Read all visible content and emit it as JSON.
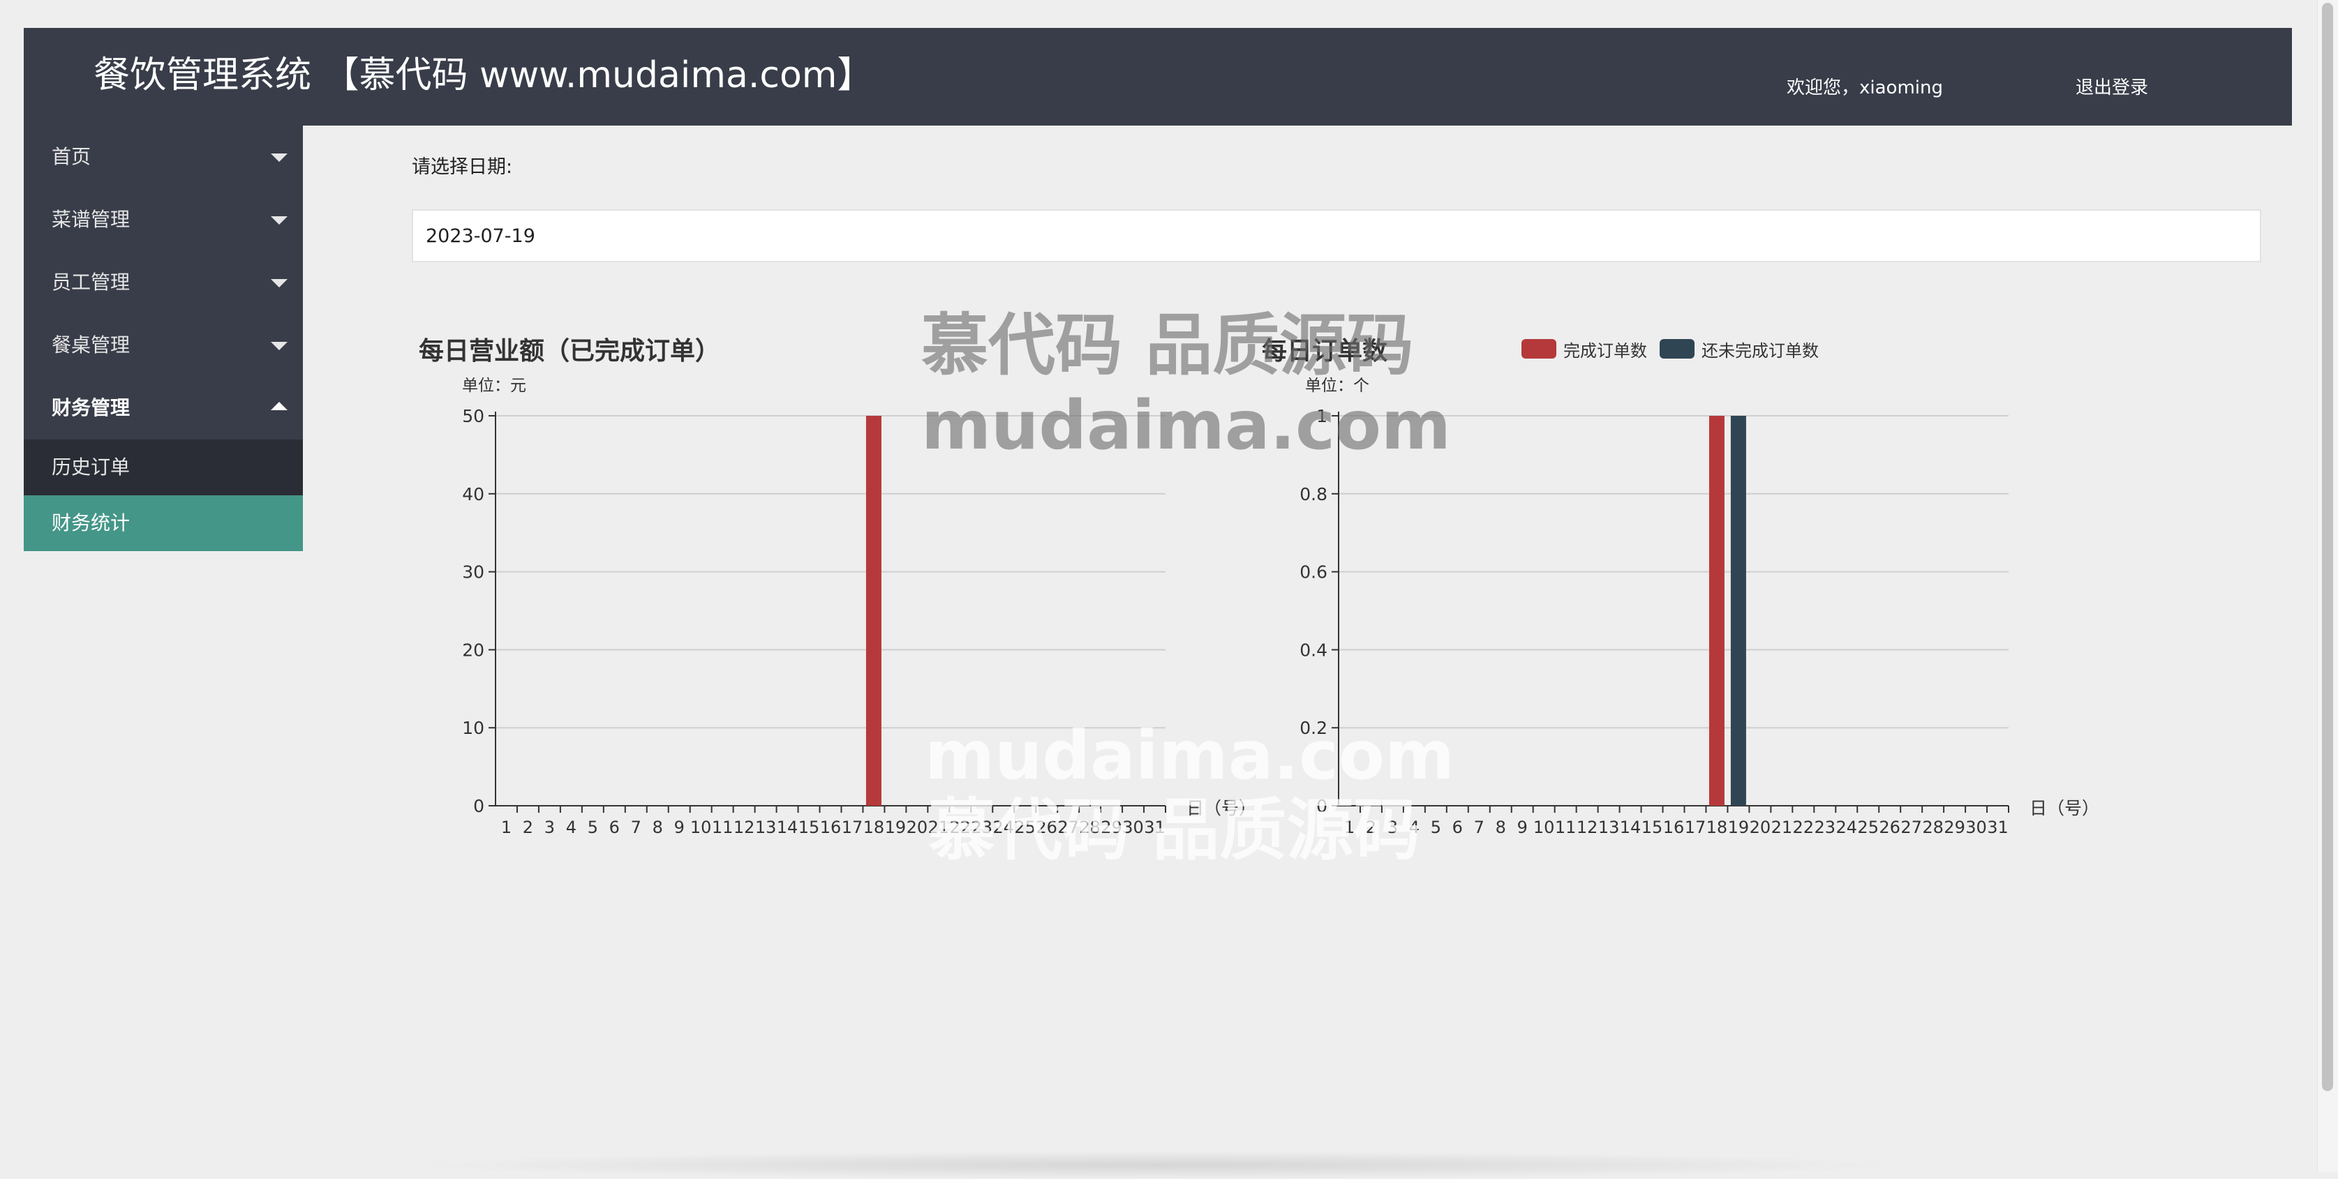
{
  "header": {
    "title": "餐饮管理系统 【慕代码 www.mudaima.com】",
    "welcome": "欢迎您，xiaoming",
    "logout": "退出登录"
  },
  "sidebar": {
    "items": [
      {
        "label": "首页"
      },
      {
        "label": "菜谱管理"
      },
      {
        "label": "员工管理"
      },
      {
        "label": "餐桌管理"
      },
      {
        "label": "财务管理"
      }
    ],
    "submenu": [
      {
        "label": "历史订单"
      },
      {
        "label": "财务统计"
      }
    ]
  },
  "main": {
    "date_label": "请选择日期:",
    "date_value": "2023-07-19"
  },
  "watermark": {
    "line1": "慕代码 品质源码",
    "line2": "mudaima.com"
  },
  "colors": {
    "header_bg": "#393d49",
    "active_menu": "#449688",
    "completed": "#b5393a",
    "uncompleted": "#2f4554"
  },
  "chart_data": [
    {
      "type": "bar",
      "title": "每日营业额（已完成订单）",
      "unit": "单位：元",
      "xlabel": "日（号）",
      "categories": [
        "1",
        "2",
        "3",
        "4",
        "5",
        "6",
        "7",
        "8",
        "9",
        "10",
        "11",
        "12",
        "13",
        "14",
        "15",
        "16",
        "17",
        "18",
        "19",
        "20",
        "21",
        "22",
        "23",
        "24",
        "25",
        "26",
        "27",
        "28",
        "29",
        "30",
        "31"
      ],
      "ylim": [
        0,
        50
      ],
      "yticks": [
        "0",
        "10",
        "20",
        "30",
        "40",
        "50"
      ],
      "series": [
        {
          "values": [
            0,
            0,
            0,
            0,
            0,
            0,
            0,
            0,
            0,
            0,
            0,
            0,
            0,
            0,
            0,
            0,
            0,
            50,
            0,
            0,
            0,
            0,
            0,
            0,
            0,
            0,
            0,
            0,
            0,
            0,
            0
          ]
        }
      ],
      "grid": true
    },
    {
      "type": "bar",
      "title": "每日订单数",
      "unit": "单位：个",
      "xlabel": "日（号）",
      "categories": [
        "1",
        "2",
        "3",
        "4",
        "5",
        "6",
        "7",
        "8",
        "9",
        "10",
        "11",
        "12",
        "13",
        "14",
        "15",
        "16",
        "17",
        "18",
        "19",
        "20",
        "21",
        "22",
        "23",
        "24",
        "25",
        "26",
        "27",
        "28",
        "29",
        "30",
        "31"
      ],
      "ylim": [
        0,
        1
      ],
      "yticks": [
        "0",
        "0.2",
        "0.4",
        "0.6",
        "0.8",
        "1"
      ],
      "series": [
        {
          "name": "完成订单数",
          "values": [
            0,
            0,
            0,
            0,
            0,
            0,
            0,
            0,
            0,
            0,
            0,
            0,
            0,
            0,
            0,
            0,
            0,
            1,
            0,
            0,
            0,
            0,
            0,
            0,
            0,
            0,
            0,
            0,
            0,
            0,
            0
          ]
        },
        {
          "name": "还未完成订单数",
          "values": [
            0,
            0,
            0,
            0,
            0,
            0,
            0,
            0,
            0,
            0,
            0,
            0,
            0,
            0,
            0,
            0,
            0,
            0,
            1,
            0,
            0,
            0,
            0,
            0,
            0,
            0,
            0,
            0,
            0,
            0,
            0
          ]
        }
      ],
      "legend": "top-right",
      "grid": true
    }
  ]
}
